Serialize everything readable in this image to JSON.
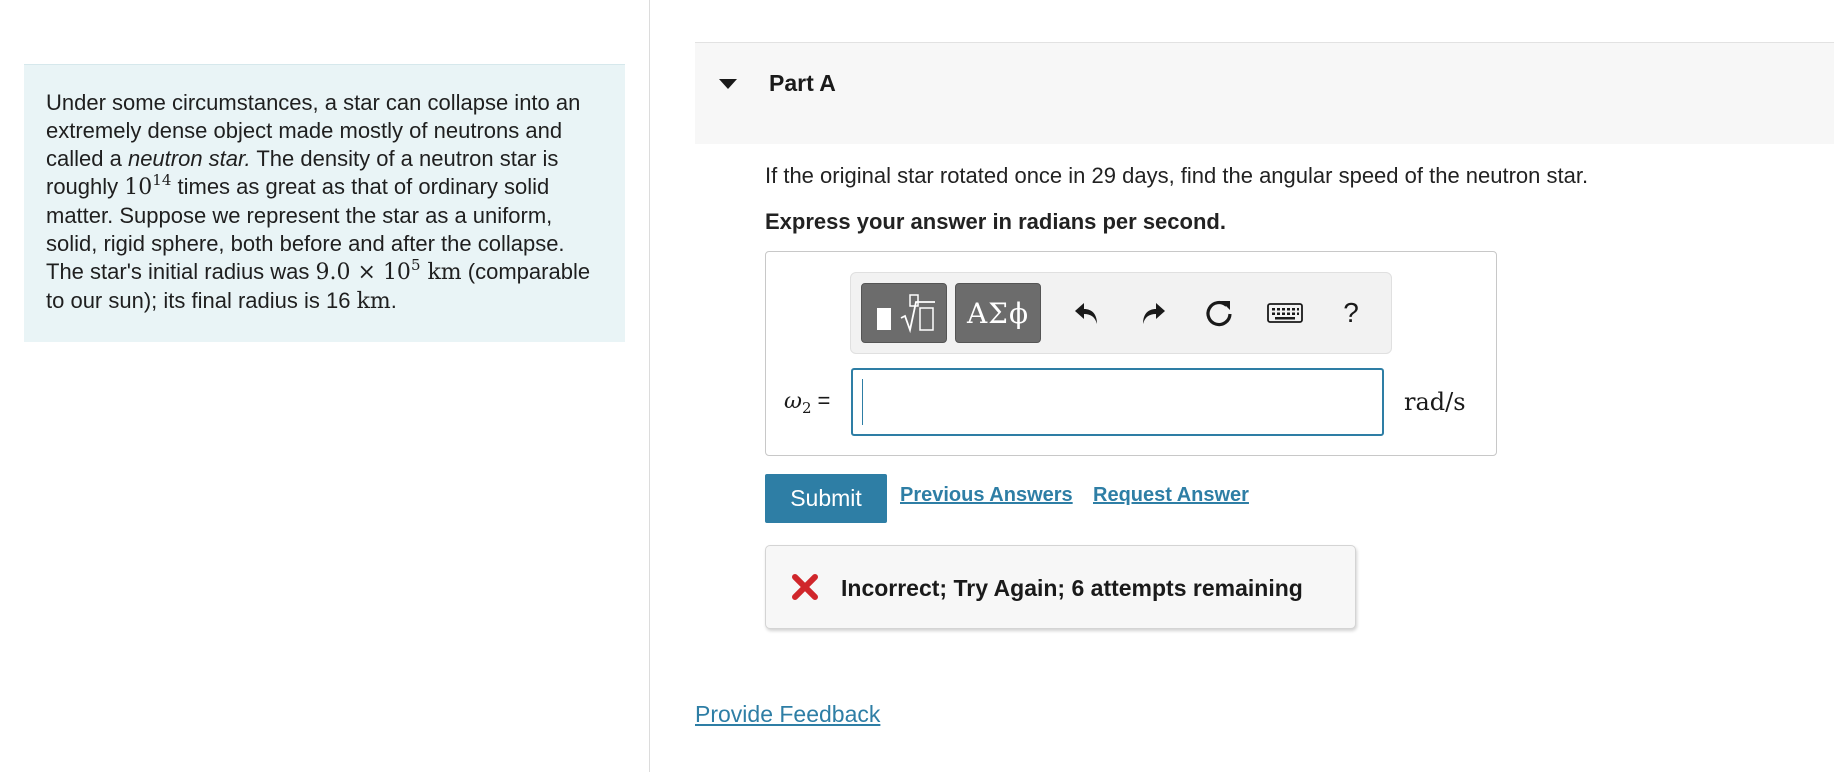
{
  "intro": {
    "s1": "Under some circumstances, a star can collapse into an extremely dense object made mostly of neutrons and called a ",
    "s1_em": "neutron star.",
    "s2": " The density of a neutron star is roughly ",
    "density_base": "10",
    "density_exp": "14",
    "s3": " times as great as that of ordinary solid matter. Suppose we represent the star as a uniform, solid, rigid sphere, both before and after the collapse. The star's initial radius was ",
    "r_initial_mantissa": "9.0 × 10",
    "r_initial_exp": "5",
    "r_initial_unit": " km",
    "s4": " (comparable to our sun); its final radius is 16 ",
    "r_final_unit": "km",
    "s5": "."
  },
  "part": {
    "title": "Part A",
    "question": "If the original star rotated once in 29 days, find the angular speed of the neutron star.",
    "instruction": "Express your answer in radians per second."
  },
  "toolbar": {
    "greek_label": "ΑΣϕ",
    "help_label": "?",
    "icons": [
      "templates-icon",
      "greek-symbols-icon",
      "undo-icon",
      "redo-icon",
      "reset-icon",
      "keyboard-icon",
      "help-icon"
    ]
  },
  "answer": {
    "var_symbol": "ω",
    "var_sub": "2",
    "equals": "=",
    "value": "",
    "unit": "rad/s"
  },
  "actions": {
    "submit_label": "Submit",
    "previous_answers_label": "Previous Answers",
    "request_answer_label": "Request Answer"
  },
  "feedback": {
    "message": "Incorrect; Try Again; 6 attempts remaining",
    "icon": "x-icon",
    "icon_color": "#d0262b"
  },
  "footer": {
    "provide_feedback_label": "Provide Feedback"
  },
  "colors": {
    "accent": "#2e7ea5",
    "intro_background": "#e9f4f6",
    "error": "#d0262b"
  }
}
